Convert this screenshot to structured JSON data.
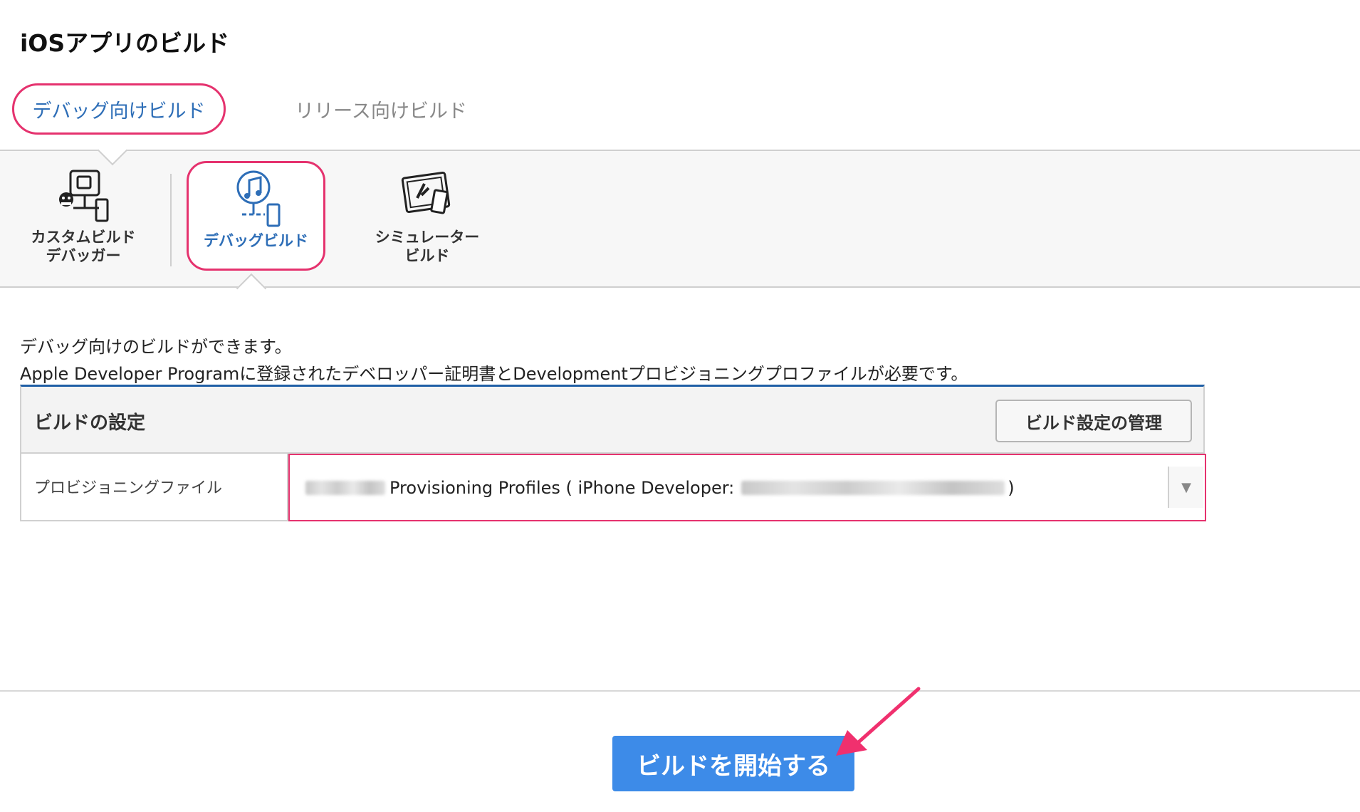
{
  "page": {
    "title": "iOSアプリのビルド"
  },
  "tabs": [
    {
      "label": "デバッグ向けビルド",
      "active": true
    },
    {
      "label": "リリース向けビルド",
      "active": false
    }
  ],
  "build_types": [
    {
      "label_line1": "カスタムビルド",
      "label_line2": "デバッガー",
      "icon": "custom-build-debugger-icon",
      "selected": false
    },
    {
      "label_line1": "デバッグビルド",
      "label_line2": "",
      "icon": "debug-build-icon",
      "selected": true
    },
    {
      "label_line1": "シミュレーター",
      "label_line2": "ビルド",
      "icon": "simulator-build-icon",
      "selected": false
    }
  ],
  "description": {
    "line1": "デバッグ向けのビルドができます。",
    "line2": "Apple Developer Programに登録されたデベロッパー証明書とDevelopmentプロビジョニングプロファイルが必要です。"
  },
  "settings": {
    "title": "ビルドの設定",
    "manage_button": "ビルド設定の管理",
    "provisioning_label": "プロビジョニングファイル",
    "provisioning_value_prefix": "Provisioning Profiles ( iPhone Developer:",
    "provisioning_value_suffix": ")"
  },
  "actions": {
    "start_build": "ビルドを開始する"
  },
  "colors": {
    "accent_pink": "#e5326e",
    "accent_blue": "#2e6eb7",
    "primary_button": "#3d8be8",
    "panel_top_border": "#1f5fa6"
  }
}
